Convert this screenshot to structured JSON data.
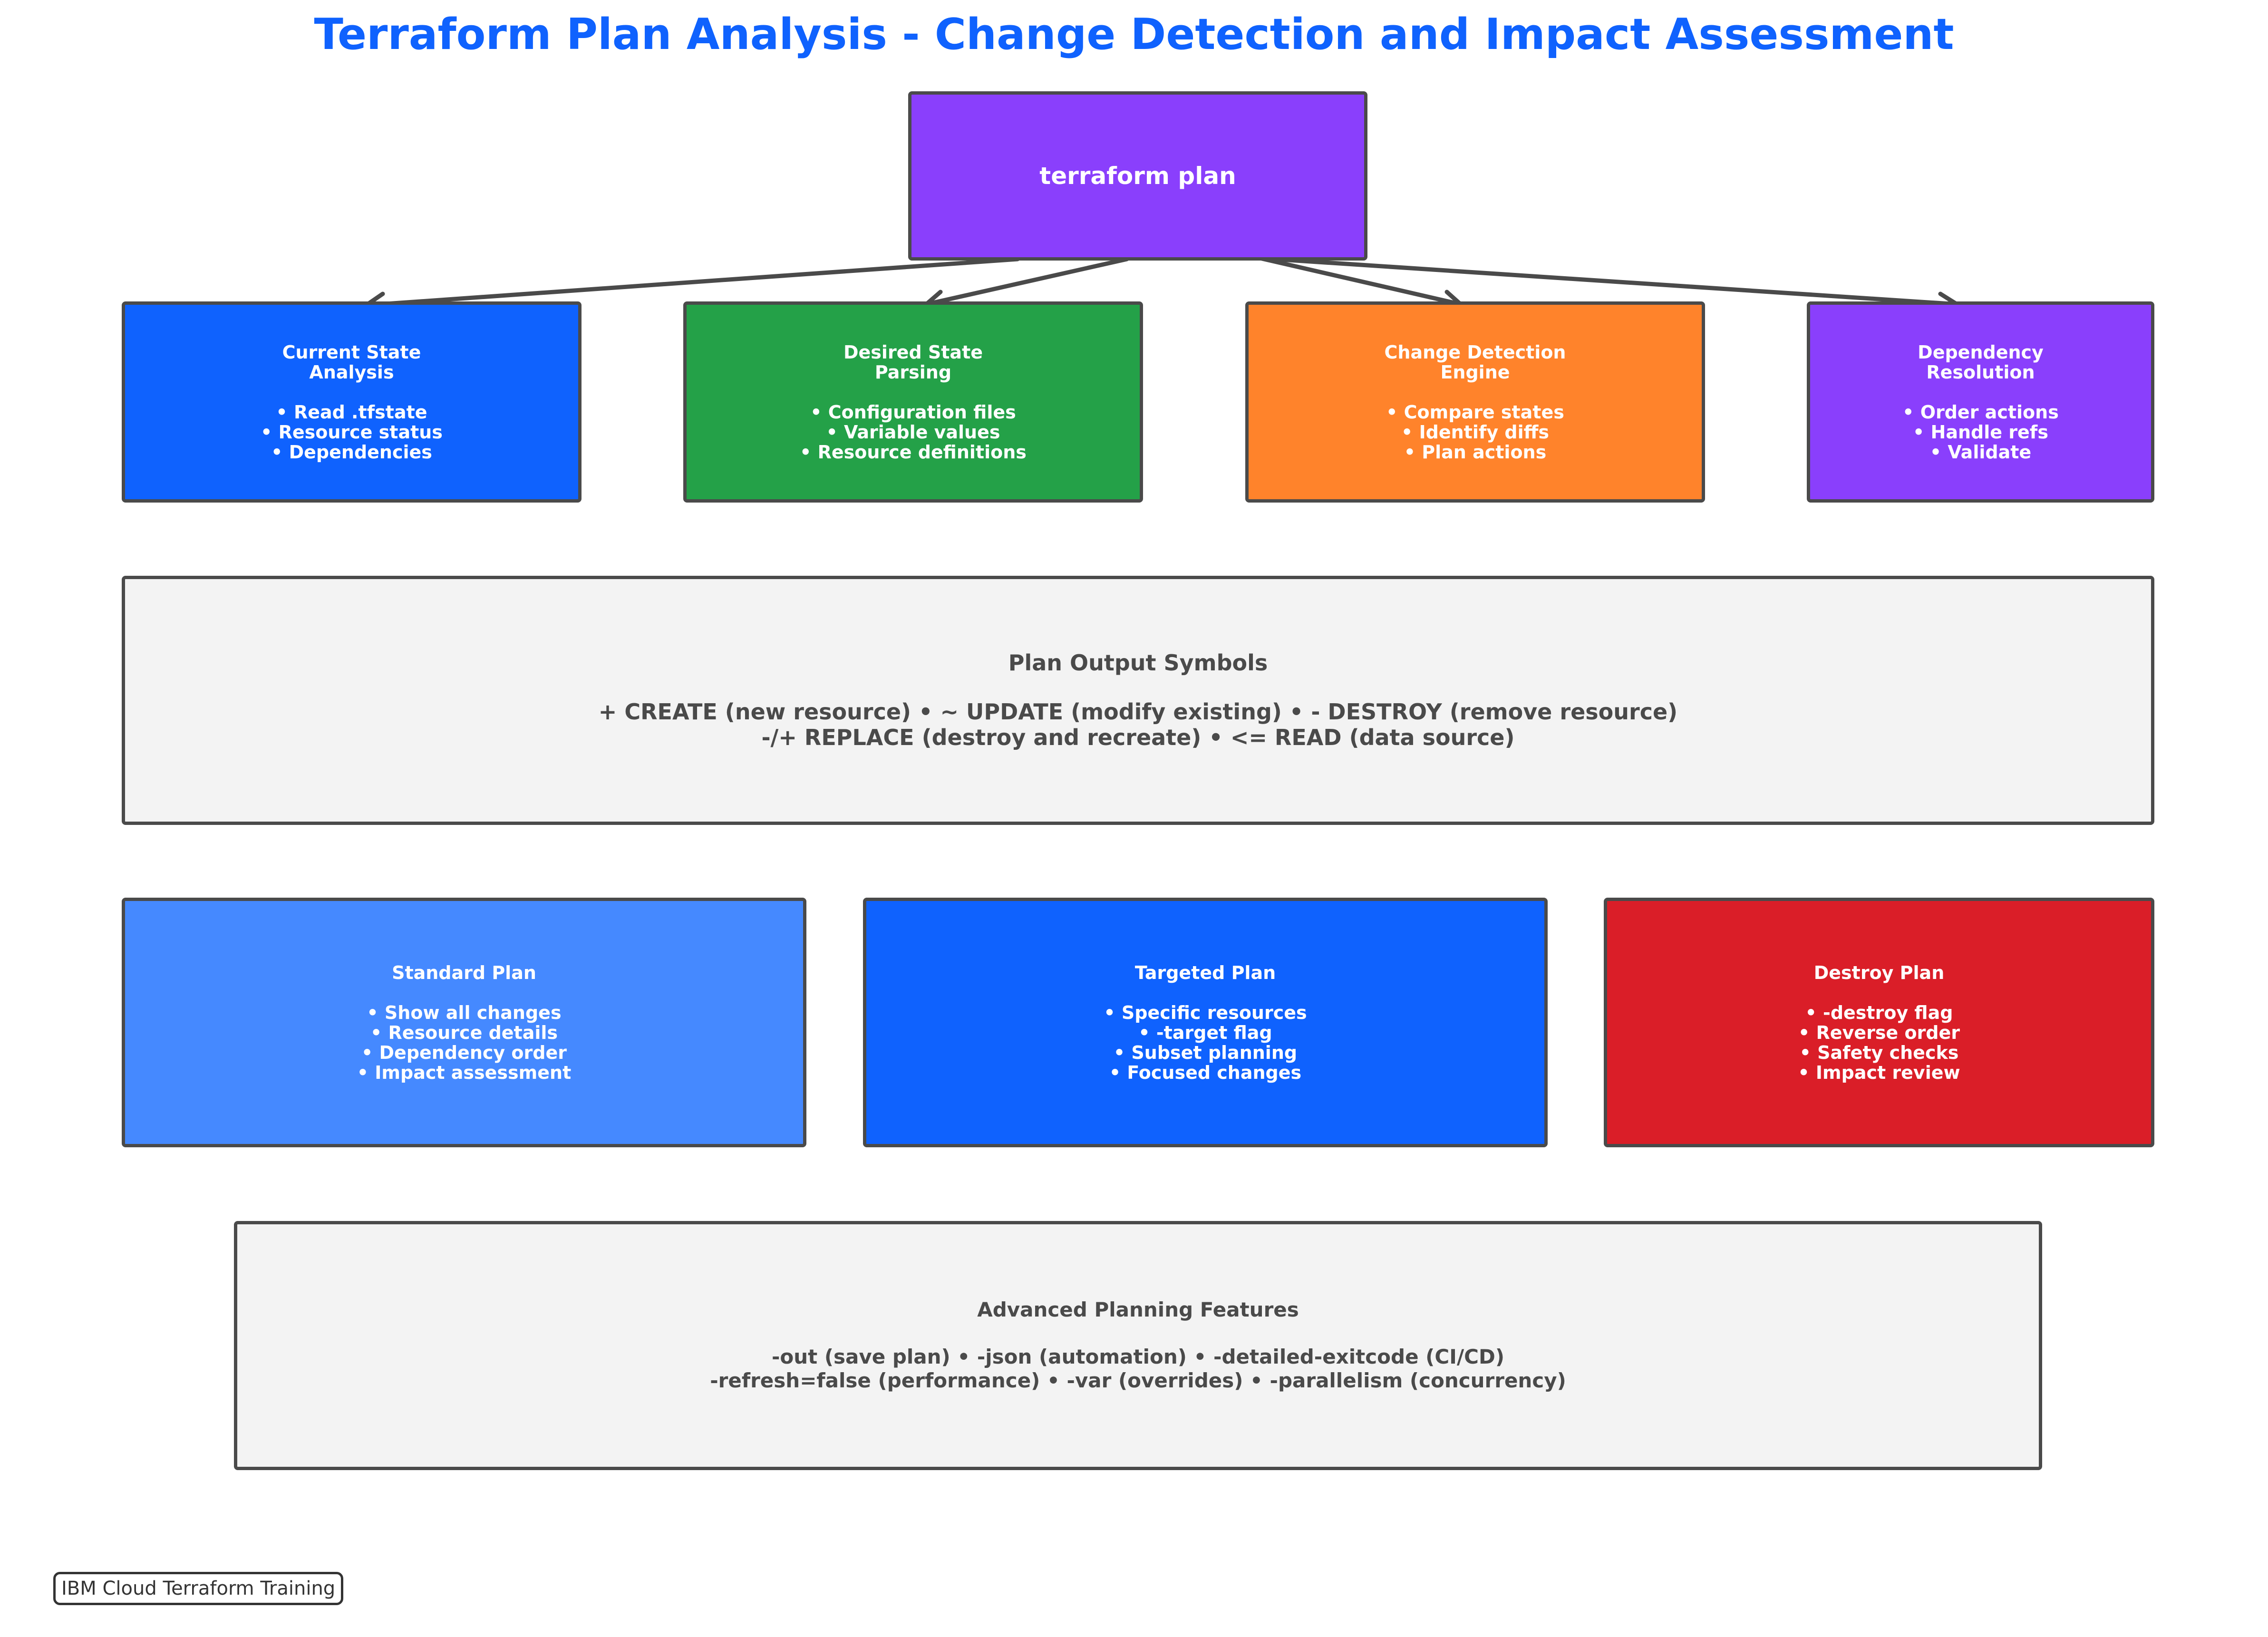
{
  "title": "Terraform Plan Analysis - Change Detection and Impact Assessment",
  "colors": {
    "title": "#0f62fe",
    "root": "#8a3ffc",
    "current_state": "#0f62fe",
    "desired_state": "#24a148",
    "change_detection": "#ff832b",
    "dependency": "#8a3ffc",
    "symbols_panel": "#f3f3f3",
    "standard_plan": "#4589ff",
    "targeted_plan": "#0f62fe",
    "destroy_plan": "#da1e28",
    "border": "#4a4a4a"
  },
  "root": {
    "label": "terraform plan"
  },
  "stages": [
    {
      "title": "Current State\nAnalysis",
      "items": [
        "• Read .tfstate",
        "• Resource status",
        "• Dependencies"
      ]
    },
    {
      "title": "Desired State\nParsing",
      "items": [
        "• Configuration files",
        "• Variable values",
        "• Resource definitions"
      ]
    },
    {
      "title": "Change Detection\nEngine",
      "items": [
        "• Compare states",
        "• Identify diffs",
        "• Plan actions"
      ]
    },
    {
      "title": "Dependency\nResolution",
      "items": [
        "• Order actions",
        "• Handle refs",
        "• Validate"
      ]
    }
  ],
  "symbols": {
    "title": "Plan Output Symbols",
    "lines": [
      "+ CREATE (new resource) • ~ UPDATE (modify existing) • - DESTROY (remove resource)",
      "-/+ REPLACE (destroy and recreate) • <= READ (data source)"
    ]
  },
  "plans": [
    {
      "title": "Standard Plan",
      "items": [
        "• Show all changes",
        "• Resource details",
        "• Dependency order",
        "• Impact assessment"
      ]
    },
    {
      "title": "Targeted Plan",
      "items": [
        "• Specific resources",
        "• -target flag",
        "• Subset planning",
        "• Focused changes"
      ]
    },
    {
      "title": "Destroy Plan",
      "items": [
        "• -destroy flag",
        "• Reverse order",
        "• Safety checks",
        "• Impact review"
      ]
    }
  ],
  "advanced": {
    "title": "Advanced Planning Features",
    "lines": [
      "-out (save plan) • -json (automation) • -detailed-exitcode (CI/CD)",
      "-refresh=false (performance) • -var (overrides) • -parallelism (concurrency)"
    ]
  },
  "footer": "IBM Cloud Terraform Training"
}
